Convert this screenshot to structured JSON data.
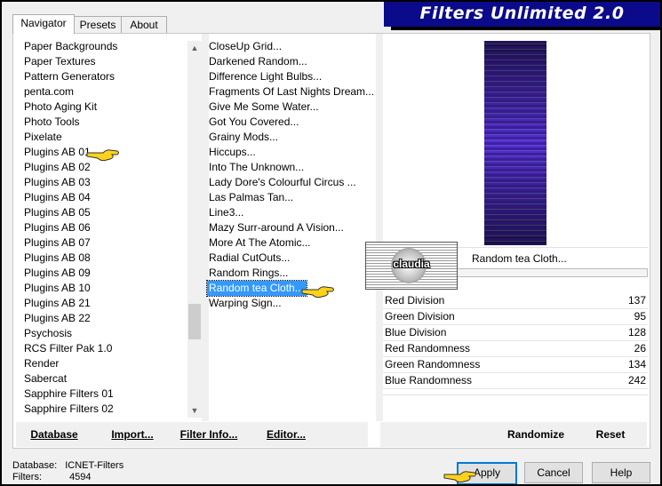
{
  "banner": {
    "title": "Filters Unlimited 2.0"
  },
  "tabs": [
    {
      "label": "Navigator",
      "active": true
    },
    {
      "label": "Presets",
      "active": false
    },
    {
      "label": "About",
      "active": false
    }
  ],
  "categories": [
    "Paper Backgrounds",
    "Paper Textures",
    "Pattern Generators",
    "penta.com",
    "Photo Aging Kit",
    "Photo Tools",
    "Pixelate",
    "Plugins AB 01",
    "Plugins AB 02",
    "Plugins AB 03",
    "Plugins AB 04",
    "Plugins AB 05",
    "Plugins AB 06",
    "Plugins AB 07",
    "Plugins AB 08",
    "Plugins AB 09",
    "Plugins AB 10",
    "Plugins AB 21",
    "Plugins AB 22",
    "Psychosis",
    "RCS Filter Pak 1.0",
    "Render",
    "Sabercat",
    "Sapphire Filters 01",
    "Sapphire Filters 02"
  ],
  "filters": [
    "CloseUp Grid...",
    "Darkened Random...",
    "Difference Light Bulbs...",
    "Fragments Of Last Nights Dream...",
    "Give Me Some Water...",
    "Got You Covered...",
    "Grainy Mods...",
    "Hiccups...",
    "Into The Unknown...",
    "Lady Dore's Colourful Circus ...",
    "Las Palmas Tan...",
    "Line3...",
    "Mazy Surr-around A Vision...",
    "More At The Atomic...",
    "Radial CutOuts...",
    "Random Rings...",
    "Random tea Cloth...",
    "Warping Sign..."
  ],
  "selected_filter_index": 16,
  "selected_filter_name": "Random tea Cloth...",
  "watermark": {
    "text": "claudia"
  },
  "parameters": [
    {
      "label": "Red Division",
      "value": "137"
    },
    {
      "label": "Green Division",
      "value": "95"
    },
    {
      "label": "Blue Division",
      "value": "128"
    },
    {
      "label": "Red Randomness",
      "value": "26"
    },
    {
      "label": "Green Randomness",
      "value": "134"
    },
    {
      "label": "Blue Randomness",
      "value": "242"
    }
  ],
  "toolbar": {
    "database": "Database",
    "import": "Import...",
    "filter_info": "Filter Info...",
    "editor": "Editor...",
    "randomize": "Randomize",
    "reset": "Reset"
  },
  "status": {
    "database_label": "Database:",
    "database_value": "ICNET-Filters",
    "filters_label": "Filters:",
    "filters_value": "4594"
  },
  "buttons": {
    "apply": "Apply",
    "cancel": "Cancel",
    "help": "Help"
  },
  "colors": {
    "banner": "#0a0a8a",
    "selection": "#3399ff",
    "preview": "#4a22c8"
  },
  "icons": [
    "pointing-hand-icon",
    "scroll-up-arrow-icon",
    "scroll-down-arrow-icon"
  ]
}
